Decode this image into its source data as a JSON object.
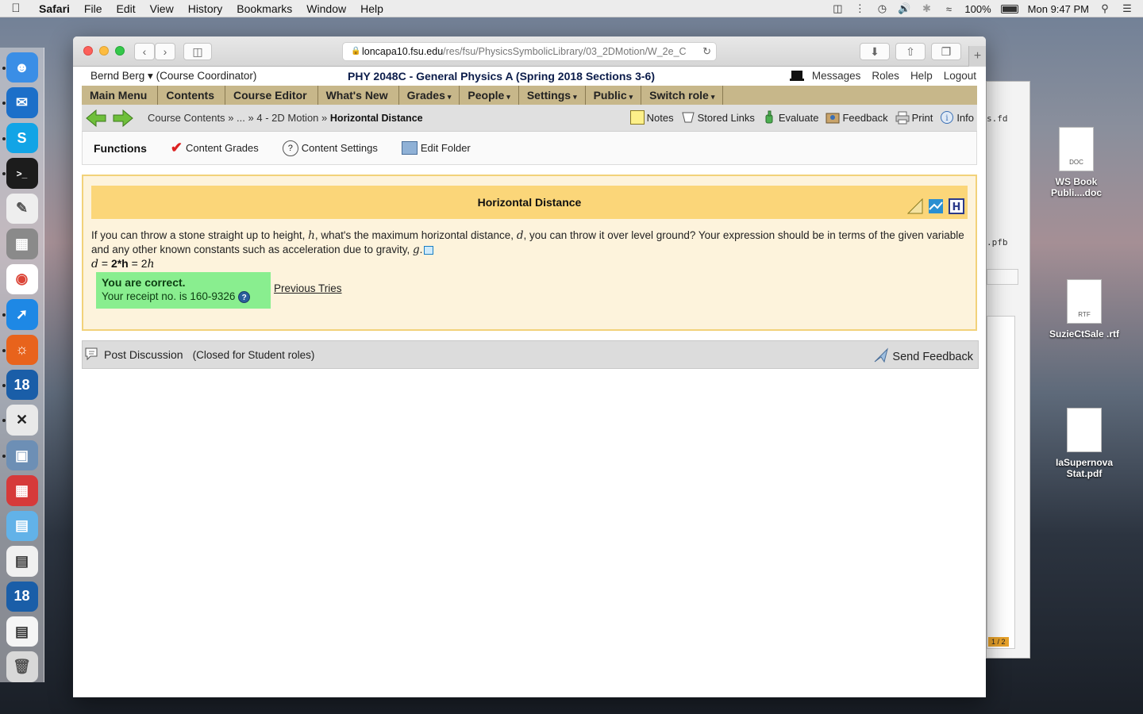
{
  "menubar": {
    "app": "Safari",
    "items": [
      "File",
      "Edit",
      "View",
      "History",
      "Bookmarks",
      "Window",
      "Help"
    ],
    "battery": "100%",
    "clock": "Mon 9:47 PM"
  },
  "desktop": {
    "files": [
      {
        "name": "WS Book Publi....doc",
        "tag": "DOC"
      },
      {
        "name": "SuzieCtSale .rtf",
        "tag": "RTF"
      },
      {
        "name": "IaSupernova Stat.pdf",
        "tag": ""
      }
    ],
    "bg_window": {
      "snippet1": "s.fd",
      "snippet2": ".pfb",
      "page": "1 / 2"
    }
  },
  "browser": {
    "url_host": "loncapa10.fsu.edu",
    "url_path": "/res/fsu/PhysicsSymbolicLibrary/03_2DMotion/W_2e_C"
  },
  "header": {
    "user": "Bernd Berg ▾",
    "role": "(Course Coordinator)",
    "course": "PHY 2048C - General Physics A (Spring 2018 Sections 3-6)",
    "links": [
      "Messages",
      "Roles",
      "Help",
      "Logout"
    ]
  },
  "nav": {
    "items": [
      {
        "label": "Main Menu",
        "caret": ""
      },
      {
        "label": "Contents",
        "caret": ""
      },
      {
        "label": "Course Editor",
        "caret": ""
      },
      {
        "label": "What's New",
        "caret": ""
      },
      {
        "label": "Grades",
        "caret": "▾"
      },
      {
        "label": "People",
        "caret": "▾"
      },
      {
        "label": "Settings",
        "caret": "▾"
      },
      {
        "label": "Public",
        "caret": "▾"
      },
      {
        "label": "Switch role",
        "caret": "▾"
      }
    ]
  },
  "breadcrumb": {
    "root": "Course Contents",
    "sep": "»",
    "ellipsis": "...",
    "folder": "4 - 2D Motion",
    "current": "Horizontal Distance"
  },
  "tools": [
    "Notes",
    "Stored Links",
    "Evaluate",
    "Feedback",
    "Print",
    "Info"
  ],
  "functions": {
    "title": "Functions",
    "items": [
      "Content Grades",
      "Content Settings",
      "Edit Folder"
    ]
  },
  "problem": {
    "title": "Horizontal Distance",
    "text_a": "If you can throw a stone straight up to height, ",
    "var_h": "h",
    "text_b": ", what's the maximum horizontal distance, ",
    "var_d": "d",
    "text_c": ", you can throw it over level ground? Your expression should be in terms of the given variable and any other known constants such as acceleration due to gravity, ",
    "var_g": "g",
    "text_d": ".",
    "answer_lhs": "d",
    "answer_eq": " = ",
    "answer_input": "2*h",
    "answer_eq2": " = 2",
    "answer_var": "h",
    "status": "You are correct.",
    "receipt": "Your receipt no. is 160-9326",
    "prev_tries": "Previous Tries"
  },
  "discussion": {
    "post": "Post Discussion",
    "closed": "(Closed for Student roles)",
    "send_feedback": "Send Feedback"
  }
}
